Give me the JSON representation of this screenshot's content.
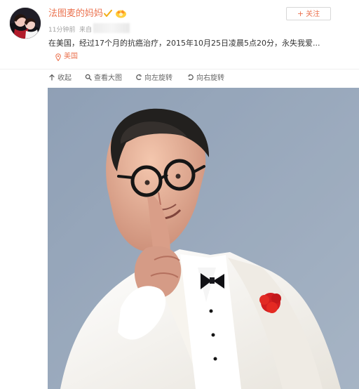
{
  "post": {
    "username": "法图麦的妈妈",
    "time": "11分钟前",
    "source": "来自",
    "text": "在美国，经过17个月的抗癌治疗，2015年10月25日凌晨5点20分，永失我爱...",
    "location": "美国"
  },
  "follow_button": {
    "label": "关注"
  },
  "toolbar": {
    "collapse": "收起",
    "view_large": "查看大图",
    "rotate_left": "向左旋转",
    "rotate_right": "向右旋转"
  },
  "icons": {
    "avatar": "avatar",
    "verified": "verified-badge-icon",
    "vip": "vip-crown-icon",
    "location": "location-pin-icon",
    "collapse": "collapse-up-arrow-icon",
    "search": "search-icon",
    "rotate_left": "rotate-left-icon",
    "rotate_right": "rotate-right-icon"
  },
  "colors": {
    "accent": "#eb7350",
    "text": "#333333",
    "meta": "#a2a2a2",
    "photo_background": "#9aaabd"
  }
}
